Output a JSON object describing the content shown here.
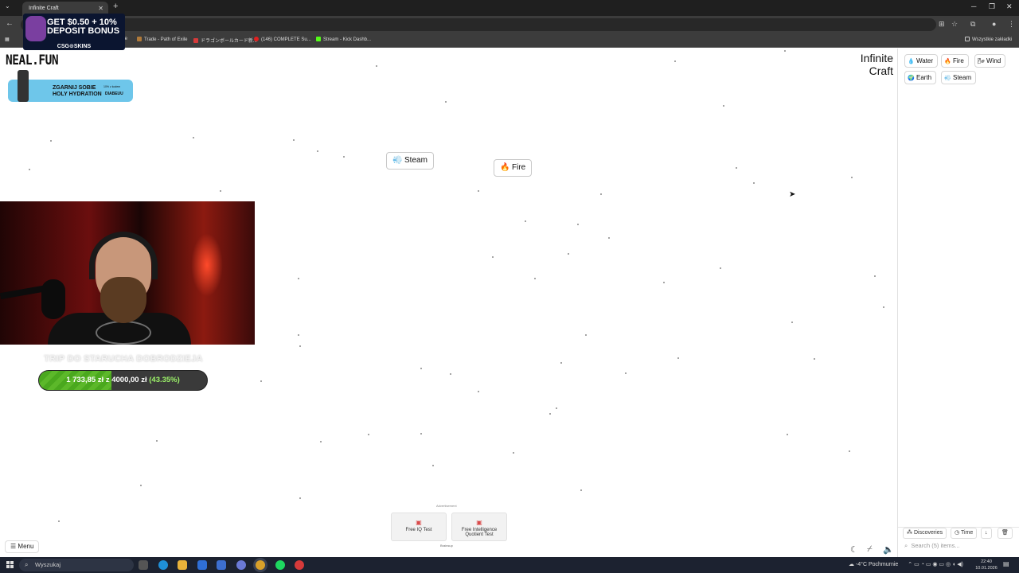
{
  "browser": {
    "tab_title": "Infinite Craft",
    "bookmarks": [
      {
        "label": "ile",
        "color": "#888888"
      },
      {
        "label": "Trade - Path of Exile",
        "color": "#b07a3a"
      },
      {
        "label": "ドラゴンボールカード新...",
        "color": "#d63a3a"
      },
      {
        "label": "(146) COMPLETE Su...",
        "color": "#e02020"
      },
      {
        "label": "Stream - Kick Dashb...",
        "color": "#53fc18"
      }
    ],
    "bookmarks_all": "Wszystkie zakładki"
  },
  "promo": {
    "text": "GET $0.50 + 10% DEPOSIT BONUS",
    "sub": "CSG⊙SKINS"
  },
  "page": {
    "logo": "NEAL.FUN",
    "game_title_line1": "Infinite",
    "game_title_line2": "Craft"
  },
  "sponsor": {
    "line1": "ZGARNIJ SOBIE",
    "line2": "HOLY HYDRATION",
    "code": "DIABEUU",
    "note": "10% z kodem"
  },
  "canvas_items": [
    {
      "label": "Steam",
      "emoji": "💨"
    },
    {
      "label": "Fire",
      "emoji": "🔥"
    }
  ],
  "sidebar": {
    "items": [
      {
        "label": "Water",
        "emoji": "💧"
      },
      {
        "label": "Fire",
        "emoji": "🔥"
      },
      {
        "label": "Wind",
        "emoji": "🌬"
      },
      {
        "label": "Earth",
        "emoji": "🌍"
      },
      {
        "label": "Steam",
        "emoji": "💨"
      }
    ],
    "discoveries_label": "Discoveries",
    "time_label": "Time",
    "sort_icon": "↓",
    "trash_icon": "🗑",
    "search_placeholder": "Search (5) items..."
  },
  "menu_label": "Menu",
  "ad": {
    "label": "Advertisement",
    "cards": [
      "Free IQ Test",
      "Free Intelligence Quotient Test"
    ],
    "source": "Brainsup"
  },
  "stream_goal": {
    "title": "TRIP DO STARUCHA DOBRODZIEJA",
    "current": "1 733,85 zł",
    "separator": "z",
    "target": "4000,00 zł",
    "percent_text": "(43.35%)",
    "progress": 0.4335
  },
  "taskbar": {
    "search_placeholder": "Wyszukaj",
    "weather": "-4°C  Pochmurnie",
    "time": "22:40",
    "date": "10.01.2026"
  }
}
